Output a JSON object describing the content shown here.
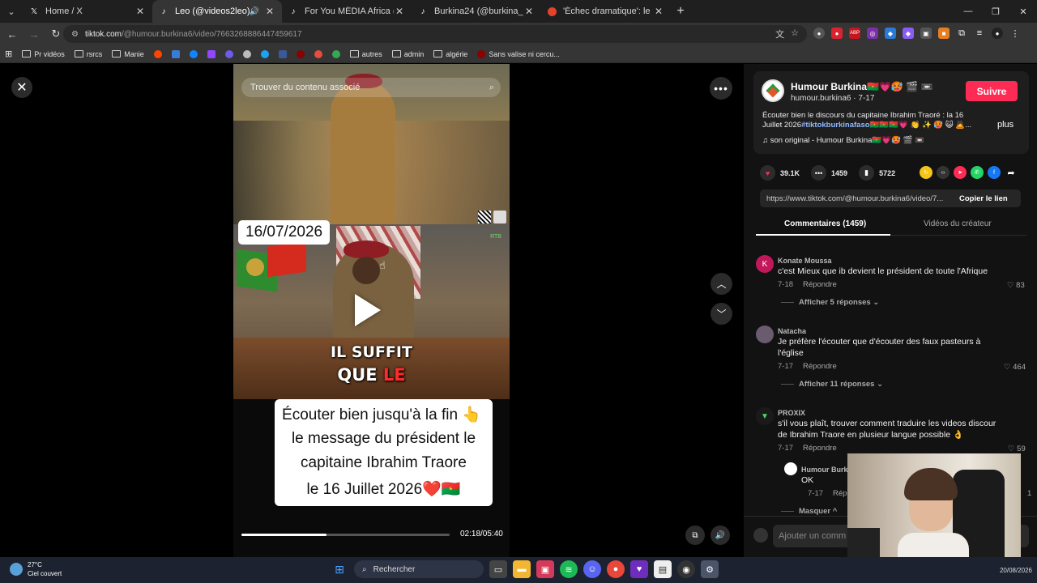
{
  "browser": {
    "tabs": [
      {
        "label": "Home / X",
        "icon": "x-logo-icon",
        "active": false
      },
      {
        "label": "Leo (@videos2leo) | TikTok",
        "icon": "tiktok-icon",
        "active": true
      },
      {
        "label": "For You MÉDIA Africa (@foryou",
        "icon": "tiktok-icon",
        "active": false
      },
      {
        "label": "Burkina24 (@burkina_24) | TikTo",
        "icon": "tiktok-icon",
        "active": false
      },
      {
        "label": "'Échec dramatique': le Burkina F",
        "icon": "news-icon",
        "active": false
      }
    ],
    "url_host": "tiktok.com",
    "url_path": "/@humour.burkina6/video/7663268886447459617",
    "bookmarks": [
      "Pr vidéos",
      "rsrcs",
      "Manie",
      "autres",
      "admin",
      "algérie",
      "Sans valise ni cercu..."
    ]
  },
  "video": {
    "search_placeholder": "Trouver du contenu associé",
    "date_badge": "16/07/2026",
    "caption_line1": "IL SUFFIT",
    "caption_line2_a": "QUE ",
    "caption_line2_b": "LE",
    "card_line1": "Écouter bien jusqu'à la fin 👆",
    "card_line2": "le message du président le",
    "card_line3": "capitaine Ibrahim Traore",
    "card_line4": "le 16 Juillet 2026❤️🇧🇫",
    "time": "02:18/05:40",
    "progress": 0.41
  },
  "side": {
    "author_name": "Humour Burkina🇧🇫💗🥵 🎬 📼",
    "author_id": "humour.burkina6 · 7-17",
    "follow_label": "Suivre",
    "desc_text": "Écouter bien le discours du capitaine Ibrahim Traoré : la 16 Juillet 2026",
    "desc_tag": "#tiktokburkinafaso",
    "desc_tail": "🇧🇫🇧🇫🇧🇫💗 👏 ✨ 🥵 😺 🙇...",
    "more_label": "plus",
    "music": "♫  son original - Humour Burkina🇧🇫💗🥵 🎬 📼",
    "likes": "39.1K",
    "comments_count": "1459",
    "saves": "5722",
    "share_link": "https://www.tiktok.com/@humour.burkina6/video/7...",
    "copy_label": "Copier le lien",
    "tab_comments": "Commentaires (1459)",
    "tab_creator": "Vidéos du créateur",
    "comments": [
      {
        "initial": "K",
        "user": "Konate Moussa",
        "text": "c'est Mieux que ib devient le président de toute l'Afrique",
        "date": "7-18",
        "reply": "Répondre",
        "likes": "83",
        "replies": "Afficher 5 réponses"
      },
      {
        "initial": "",
        "user": "Natacha",
        "text": "Je préfère l'écouter que d'écouter des faux pasteurs à l'église",
        "date": "7-17",
        "reply": "Répondre",
        "likes": "464",
        "replies": "Afficher 11 réponses"
      },
      {
        "initial": "",
        "user": "PROXIX",
        "text": "s'il vous plaît, trouver comment traduire les videos discour de Ibrahim Traore en plusieur langue possible 👌",
        "date": "7-17",
        "reply": "Répondre",
        "likes": "59",
        "replies": ""
      }
    ],
    "sub_reply": {
      "user": "Humour Burki",
      "text": "OK",
      "date": "7-17",
      "reply": "Répond",
      "likes": "1"
    },
    "hide_label": "Masquer",
    "add_comment_placeholder": "Ajouter un comm"
  },
  "taskbar": {
    "temperature": "27°C",
    "weather": "Ciel couvert",
    "search_label": "Rechercher",
    "date": "20/08/2026"
  },
  "colors": {
    "accent": "#fe2c55",
    "tag": "#8fb9ff"
  }
}
